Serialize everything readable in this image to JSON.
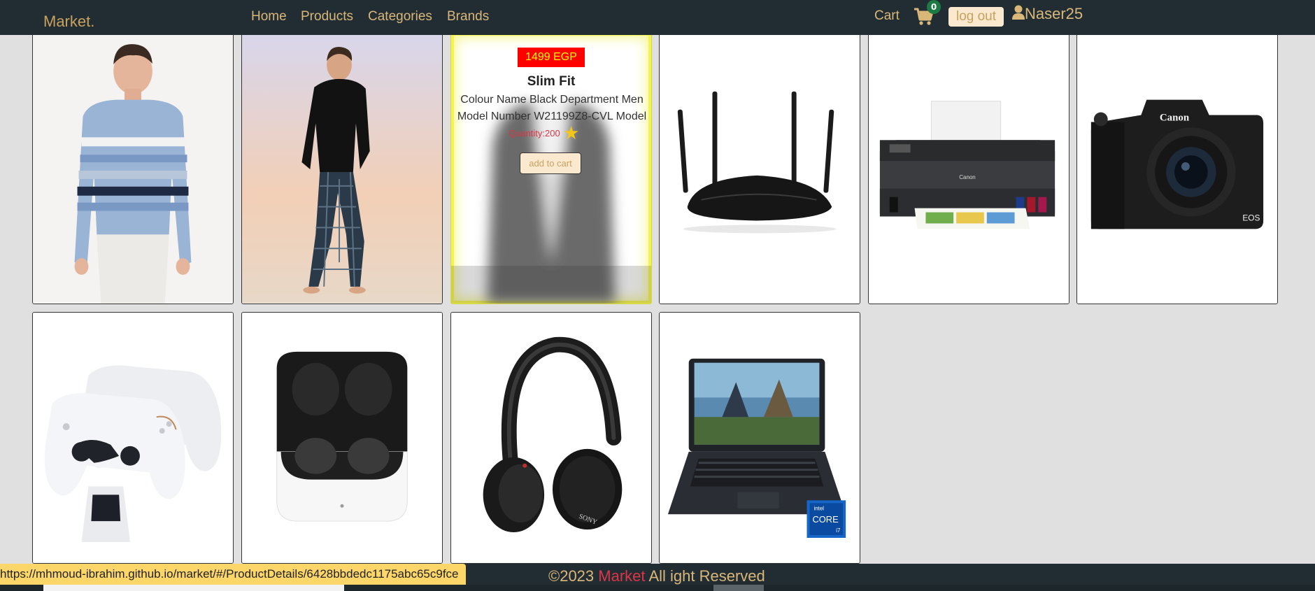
{
  "nav": {
    "brand": "Market.",
    "links": [
      "Home",
      "Products",
      "Categories",
      "Brands"
    ],
    "cart_label": "Cart",
    "cart_count": "0",
    "logout_label": "log out",
    "username": "Naser25"
  },
  "hovered_product": {
    "price": "1499 EGP",
    "title": "Slim Fit",
    "desc_line1": "Colour Name Black Department Men",
    "desc_line2": "Model Number W21199Z8-CVL Model",
    "quantity": "Quantity:200",
    "add_to_cart": "add to cart"
  },
  "products": [
    {
      "kind": "sweater",
      "icon": "sweater-model-image"
    },
    {
      "kind": "pajama",
      "icon": "pajama-model-image"
    },
    {
      "kind": "slimfit",
      "icon": "slim-fit-image"
    },
    {
      "kind": "router",
      "icon": "router-image"
    },
    {
      "kind": "printer",
      "icon": "printer-image"
    },
    {
      "kind": "camera",
      "icon": "camera-image"
    },
    {
      "kind": "controllers",
      "icon": "game-controllers-image"
    },
    {
      "kind": "earbuds",
      "icon": "earbuds-image"
    },
    {
      "kind": "headphones",
      "icon": "headphones-image"
    },
    {
      "kind": "laptop",
      "icon": "laptop-image"
    }
  ],
  "footer": {
    "copyright": "©2023",
    "brand": "Market",
    "rights": "All ight Reserved"
  },
  "status_url": "https://mhmoud-ibrahim.github.io/market/#/ProductDetails/6428bbdedc1175abc65c9fce",
  "colors": {
    "navbar_bg": "#212d33",
    "nav_text": "#d9b779",
    "price_bg": "#ff0000",
    "price_text": "#ffff00",
    "badge": "#1e7a44",
    "footer_brand": "#dc3545"
  }
}
